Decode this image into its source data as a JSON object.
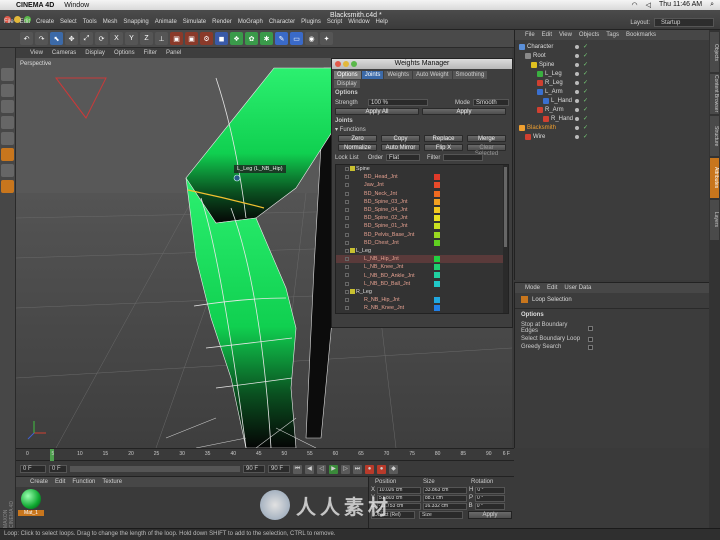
{
  "mac_menubar": {
    "app_name": "CINEMA 4D",
    "menu": [
      "Window"
    ],
    "clock": "Thu 11:46 AM"
  },
  "app": {
    "doc_title": "Blacksmith.c4d *",
    "menu": [
      "File",
      "Edit",
      "Create",
      "Select",
      "Tools",
      "Mesh",
      "Snapping",
      "Animate",
      "Simulate",
      "Render",
      "MoGraph",
      "Character",
      "Plugins",
      "Script",
      "Window",
      "Help"
    ],
    "layout_label": "Layout:",
    "layout_value": "Startup"
  },
  "viewport": {
    "menu": [
      "View",
      "Cameras",
      "Display",
      "Options",
      "Filter",
      "Panel"
    ],
    "label": "Perspective",
    "joint_tooltip": "L_Leg (L_NB_Hip)"
  },
  "weights_manager": {
    "title": "Weights Manager",
    "tabs": [
      "Options",
      "Joints",
      "Weights",
      "Auto Weight",
      "Smoothing",
      "Display"
    ],
    "options_header": "Options",
    "strength_label": "Strength",
    "strength_value": "100 %",
    "mode_label": "Mode",
    "mode_value": "Smooth",
    "apply_all": "Apply All",
    "apply": "Apply",
    "joints_header": "Joints",
    "functions_header": "▾ Functions",
    "functions": [
      "Zero",
      "Copy",
      "Replace",
      "Merge",
      "Normalize",
      "Auto Mirror",
      "Flip X",
      "Clear Selected"
    ],
    "lock_list": "Lock List",
    "order_label": "Order",
    "order_value": "Flat",
    "filter_label": "Filter",
    "joint_rows": [
      {
        "name": "Spine",
        "group": true,
        "color": ""
      },
      {
        "name": "BD_Head_Jnt",
        "group": false,
        "color": "#e03a2a"
      },
      {
        "name": "Jaw_Jnt",
        "group": false,
        "color": "#e84a2a"
      },
      {
        "name": "BD_Neck_Jnt",
        "group": false,
        "color": "#f06a20"
      },
      {
        "name": "BD_Spine_03_Jnt",
        "group": false,
        "color": "#f2a020"
      },
      {
        "name": "BD_Spine_04_Jnt",
        "group": false,
        "color": "#f2c820"
      },
      {
        "name": "BD_Spine_02_Jnt",
        "group": false,
        "color": "#e8e020"
      },
      {
        "name": "BD_Spine_01_Jnt",
        "group": false,
        "color": "#c8e020"
      },
      {
        "name": "BD_Pelvis_Base_Jnt",
        "group": false,
        "color": "#9ad820"
      },
      {
        "name": "BD_Chest_Jnt",
        "group": false,
        "color": "#60d020"
      },
      {
        "name": "L_Leg",
        "group": true,
        "color": ""
      },
      {
        "name": "L_NB_Hip_Jnt",
        "group": false,
        "color": "#20d040",
        "selected": true
      },
      {
        "name": "L_NB_Knee_Jnt",
        "group": false,
        "color": "#20d070"
      },
      {
        "name": "L_NB_BD_Ankle_Jnt",
        "group": false,
        "color": "#20d0a0"
      },
      {
        "name": "L_NB_BD_Ball_Jnt",
        "group": false,
        "color": "#20c8c8"
      },
      {
        "name": "R_Leg",
        "group": true,
        "color": ""
      },
      {
        "name": "R_NB_Hip_Jnt",
        "group": false,
        "color": "#20a8e0"
      },
      {
        "name": "R_NB_Knee_Jnt",
        "group": false,
        "color": "#2080e8"
      },
      {
        "name": "R_NB_BD_Ankle_Jnt",
        "group": false,
        "color": "#2a60f0"
      }
    ]
  },
  "object_manager": {
    "menu": [
      "File",
      "Edit",
      "View",
      "Objects",
      "Tags",
      "Bookmarks"
    ],
    "rows": [
      {
        "name": "Character",
        "indent": 0,
        "color": "#5a8fd8"
      },
      {
        "name": "Root",
        "indent": 1,
        "color": "#8a8a8a"
      },
      {
        "name": "Spine",
        "indent": 2,
        "color": "#e0c020"
      },
      {
        "name": "L_Leg",
        "indent": 3,
        "color": "#3ab040"
      },
      {
        "name": "R_Leg",
        "indent": 3,
        "color": "#d04030"
      },
      {
        "name": "L_Arm",
        "indent": 3,
        "color": "#3a70d0"
      },
      {
        "name": "L_Hand",
        "indent": 4,
        "color": "#3a70d0"
      },
      {
        "name": "R_Arm",
        "indent": 3,
        "color": "#d04030"
      },
      {
        "name": "R_Hand",
        "indent": 4,
        "color": "#d04030"
      },
      {
        "name": "Blacksmith",
        "indent": 0,
        "color": "#f0a030",
        "selected": true
      },
      {
        "name": "Wire",
        "indent": 1,
        "color": "#d04030"
      }
    ]
  },
  "attributes": {
    "menu": [
      "Mode",
      "Edit",
      "User Data"
    ],
    "tool_name": "Loop Selection",
    "options_header": "Options",
    "options": [
      "Stop at Boundary Edges",
      "Select Boundary Loop",
      "Greedy Search"
    ]
  },
  "side_tabs": [
    "Objects",
    "Content Browser",
    "Structure",
    "Attributes",
    "Layers"
  ],
  "timeline": {
    "ticks": [
      "0",
      "5",
      "10",
      "15",
      "20",
      "25",
      "30",
      "35",
      "40",
      "45",
      "50",
      "55",
      "60",
      "65",
      "70",
      "75",
      "80",
      "85",
      "90"
    ],
    "current_frame_label": "6 F",
    "start_frame": "0 F",
    "slider_start": "0 F",
    "slider_end": "90 F",
    "end_frame": "90 F"
  },
  "material_manager": {
    "menu": [
      "Create",
      "Edit",
      "Function",
      "Texture"
    ],
    "material_name": "Mat_1",
    "brand": "MAXON CINEMA 4D"
  },
  "coordinates": {
    "headers": [
      "Position",
      "Size",
      "Rotation"
    ],
    "rows": [
      {
        "axis": "X",
        "pos": "10.026 cm",
        "size": "33.863 cm",
        "rot_axis": "H",
        "rot": "0 °"
      },
      {
        "axis": "Y",
        "pos": "51.803 cm",
        "size": "88.1 cm",
        "rot_axis": "P",
        "rot": "0 °"
      },
      {
        "axis": "Z",
        "pos": "-11.753 cm",
        "size": "16.332 cm",
        "rot_axis": "B",
        "rot": "0 °"
      }
    ],
    "mode_value": "Object (Rel)",
    "size_mode": "Size",
    "apply": "Apply"
  },
  "statusbar": {
    "text": "Loop: Click to select loops. Drag to change the length of the loop. Hold down SHIFT to add to the selection, CTRL to remove."
  },
  "watermark": {
    "text": "人人素材"
  }
}
